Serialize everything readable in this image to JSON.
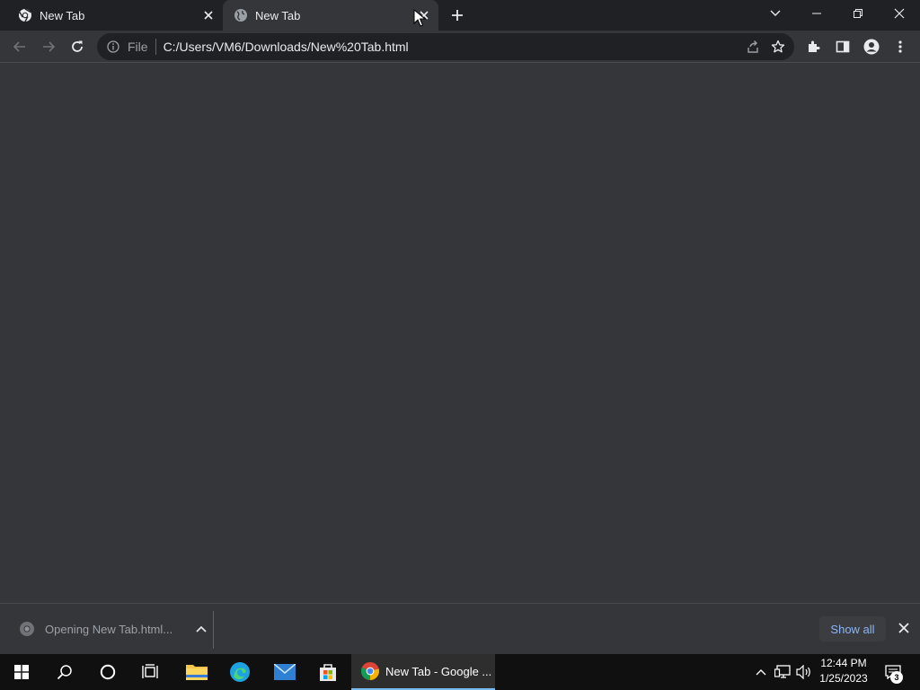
{
  "browser": {
    "tabs": [
      {
        "title": "New Tab",
        "active": false,
        "icon": "chrome-logo-icon"
      },
      {
        "title": "New Tab",
        "active": true,
        "icon": "globe-icon"
      }
    ],
    "omnibox": {
      "scheme_label": "File",
      "url": "C:/Users/VM6/Downloads/New%20Tab.html"
    }
  },
  "download_bar": {
    "item_label": "Opening New Tab.html...",
    "show_all_label": "Show all"
  },
  "taskbar": {
    "active_app_label": "New Tab - Google ...",
    "time": "12:44 PM",
    "date": "1/25/2023",
    "notification_count": "3"
  },
  "colors": {
    "accent": "#8ab4f8",
    "frame": "#202124",
    "surface": "#35363a",
    "taskbar": "#101010"
  }
}
